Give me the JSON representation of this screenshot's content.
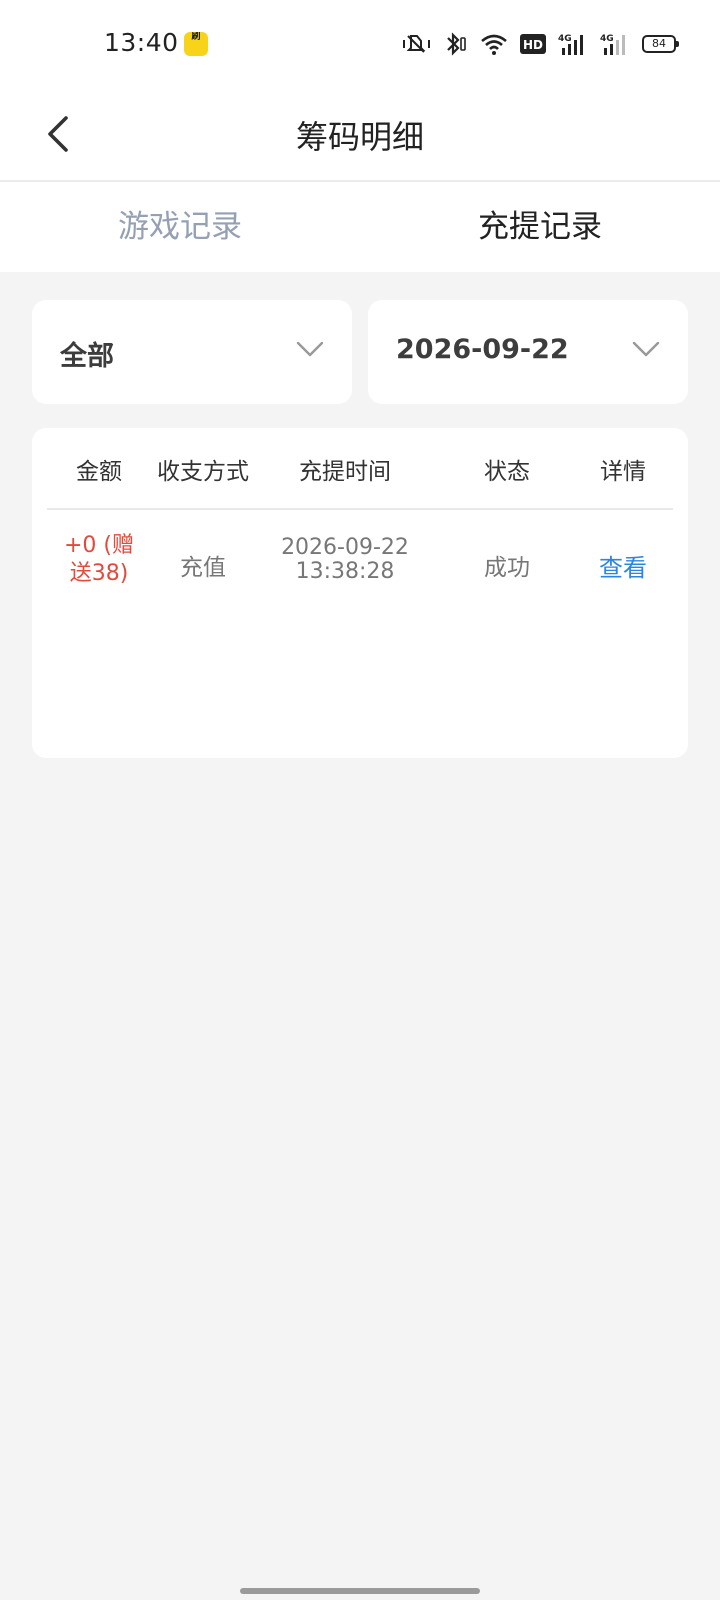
{
  "status_bar": {
    "time": "13:40",
    "app_badge": "刷",
    "battery": "84",
    "icons": [
      "vibrate-mute-icon",
      "bluetooth-icon",
      "wifi-icon",
      "hd-icon",
      "signal-4g-icon",
      "signal-4g-icon",
      "battery-icon"
    ],
    "hd_label": "HD",
    "net_label": "4G"
  },
  "nav": {
    "title": "筹码明细",
    "back_icon": "back-chevron-icon"
  },
  "tabs": [
    {
      "label": "游戏记录",
      "active": false
    },
    {
      "label": "充提记录",
      "active": true
    }
  ],
  "filters": {
    "type": {
      "selected": "全部"
    },
    "date": {
      "selected": "2026-09-22"
    }
  },
  "table": {
    "headers": [
      "金额",
      "收支方式",
      "充提时间",
      "状态",
      "详情"
    ],
    "rows": [
      {
        "amount_line1": "+0 (赠",
        "amount_line2": "送38)",
        "method": "充值",
        "date": "2026-09-22",
        "time": "13:38:28",
        "status": "成功",
        "detail": "查看"
      }
    ]
  },
  "colors": {
    "accent_blue": "#2a86e2",
    "amount_red": "#e24a3b",
    "inactive_tab": "#95a0b4",
    "background": "#f4f4f4"
  }
}
